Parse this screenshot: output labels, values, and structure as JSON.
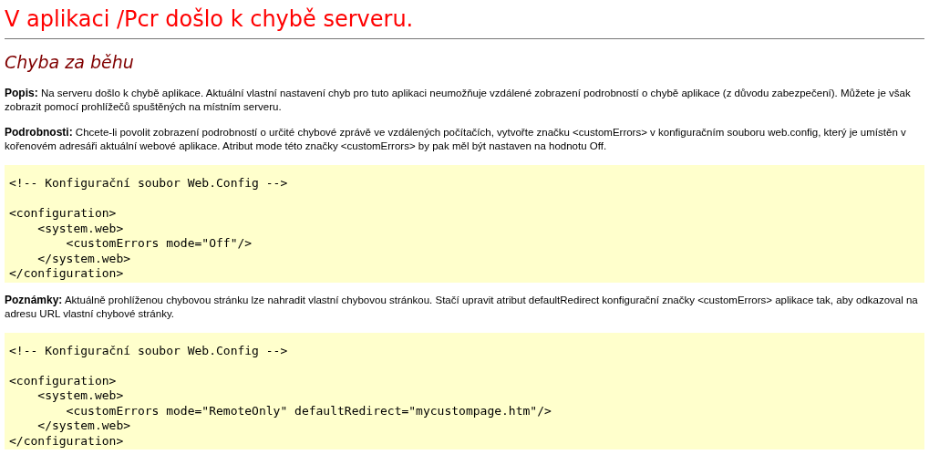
{
  "title": "V aplikaci /Pcr došlo k chybě serveru.",
  "subtitle": "Chyba za běhu",
  "blocks": [
    {
      "kind": "paragraph",
      "label": "Popis:",
      "text": "Na serveru došlo k chybě aplikace. Aktuální vlastní nastavení chyb pro tuto aplikaci neumožňuje vzdálené zobrazení podrobností o chybě aplikace (z důvodu zabezpečení). Můžete je však zobrazit pomocí prohlížečů spuštěných na místním serveru."
    },
    {
      "kind": "paragraph",
      "label": "Podrobnosti:",
      "text": "Chcete-li povolit zobrazení podrobností o určité chybové zprávě ve vzdálených počítačích, vytvořte značku <customErrors> v konfiguračním souboru web.config, který je umístěn v kořenovém adresáři aktuální webové aplikace. Atribut mode této značky <customErrors> by pak měl být nastaven na hodnotu Off."
    },
    {
      "kind": "code",
      "comment": "<!-- Konfigurační soubor Web.Config -->",
      "lines": [
        "<configuration>",
        "    <system.web>",
        "        <customErrors mode=\"Off\"/>",
        "    </system.web>",
        "</configuration>"
      ]
    },
    {
      "kind": "paragraph",
      "label": "Poznámky:",
      "text": "Aktuálně prohlíženou chybovou stránku lze nahradit vlastní chybovou stránkou. Stačí upravit atribut defaultRedirect konfigurační značky <customErrors> aplikace tak, aby odkazoval na adresu URL vlastní chybové stránky."
    },
    {
      "kind": "code",
      "comment": "<!-- Konfigurační soubor Web.Config -->",
      "lines": [
        "<configuration>",
        "    <system.web>",
        "        <customErrors mode=\"RemoteOnly\" defaultRedirect=\"mycustompage.htm\"/>",
        "    </system.web>",
        "</configuration>"
      ]
    }
  ]
}
